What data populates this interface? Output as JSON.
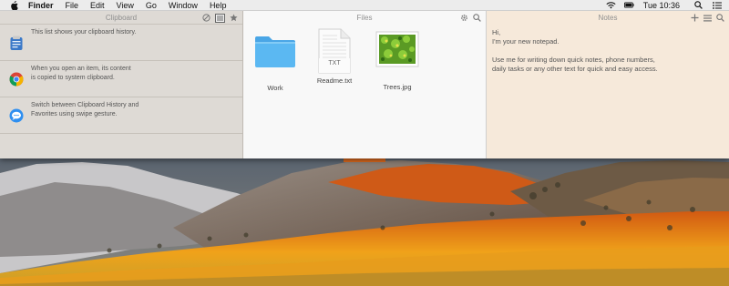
{
  "menubar": {
    "app_name": "Finder",
    "items": [
      "File",
      "Edit",
      "View",
      "Go",
      "Window",
      "Help"
    ],
    "clock": "Tue 10:36"
  },
  "clipboard": {
    "title": "Clipboard",
    "items": [
      {
        "icon": "clipboard-app-icon",
        "text": "This list shows your clipboard history."
      },
      {
        "icon": "chrome-icon",
        "text": "When you open an item, its content\nis copied to system clipboard."
      },
      {
        "icon": "messages-icon",
        "text": "Switch between Clipboard History and\nFavorites using swipe gesture."
      }
    ]
  },
  "files": {
    "title": "Files",
    "items": [
      {
        "name": "Work",
        "type": "folder"
      },
      {
        "name": "Readme.txt",
        "type": "text",
        "badge": "TXT"
      },
      {
        "name": "Trees.jpg",
        "type": "image"
      }
    ]
  },
  "notes": {
    "title": "Notes",
    "body_line1": "Hi,\nI'm your new notepad.",
    "body_line2": "Use me for writing down quick notes, phone numbers,\ndaily tasks or any other text for quick and easy access."
  },
  "colors": {
    "clipboard_bg": "#dedad5",
    "files_bg": "#f8f8f8",
    "notes_bg": "#f6e9da",
    "folder_blue": "#5bb8f2"
  }
}
